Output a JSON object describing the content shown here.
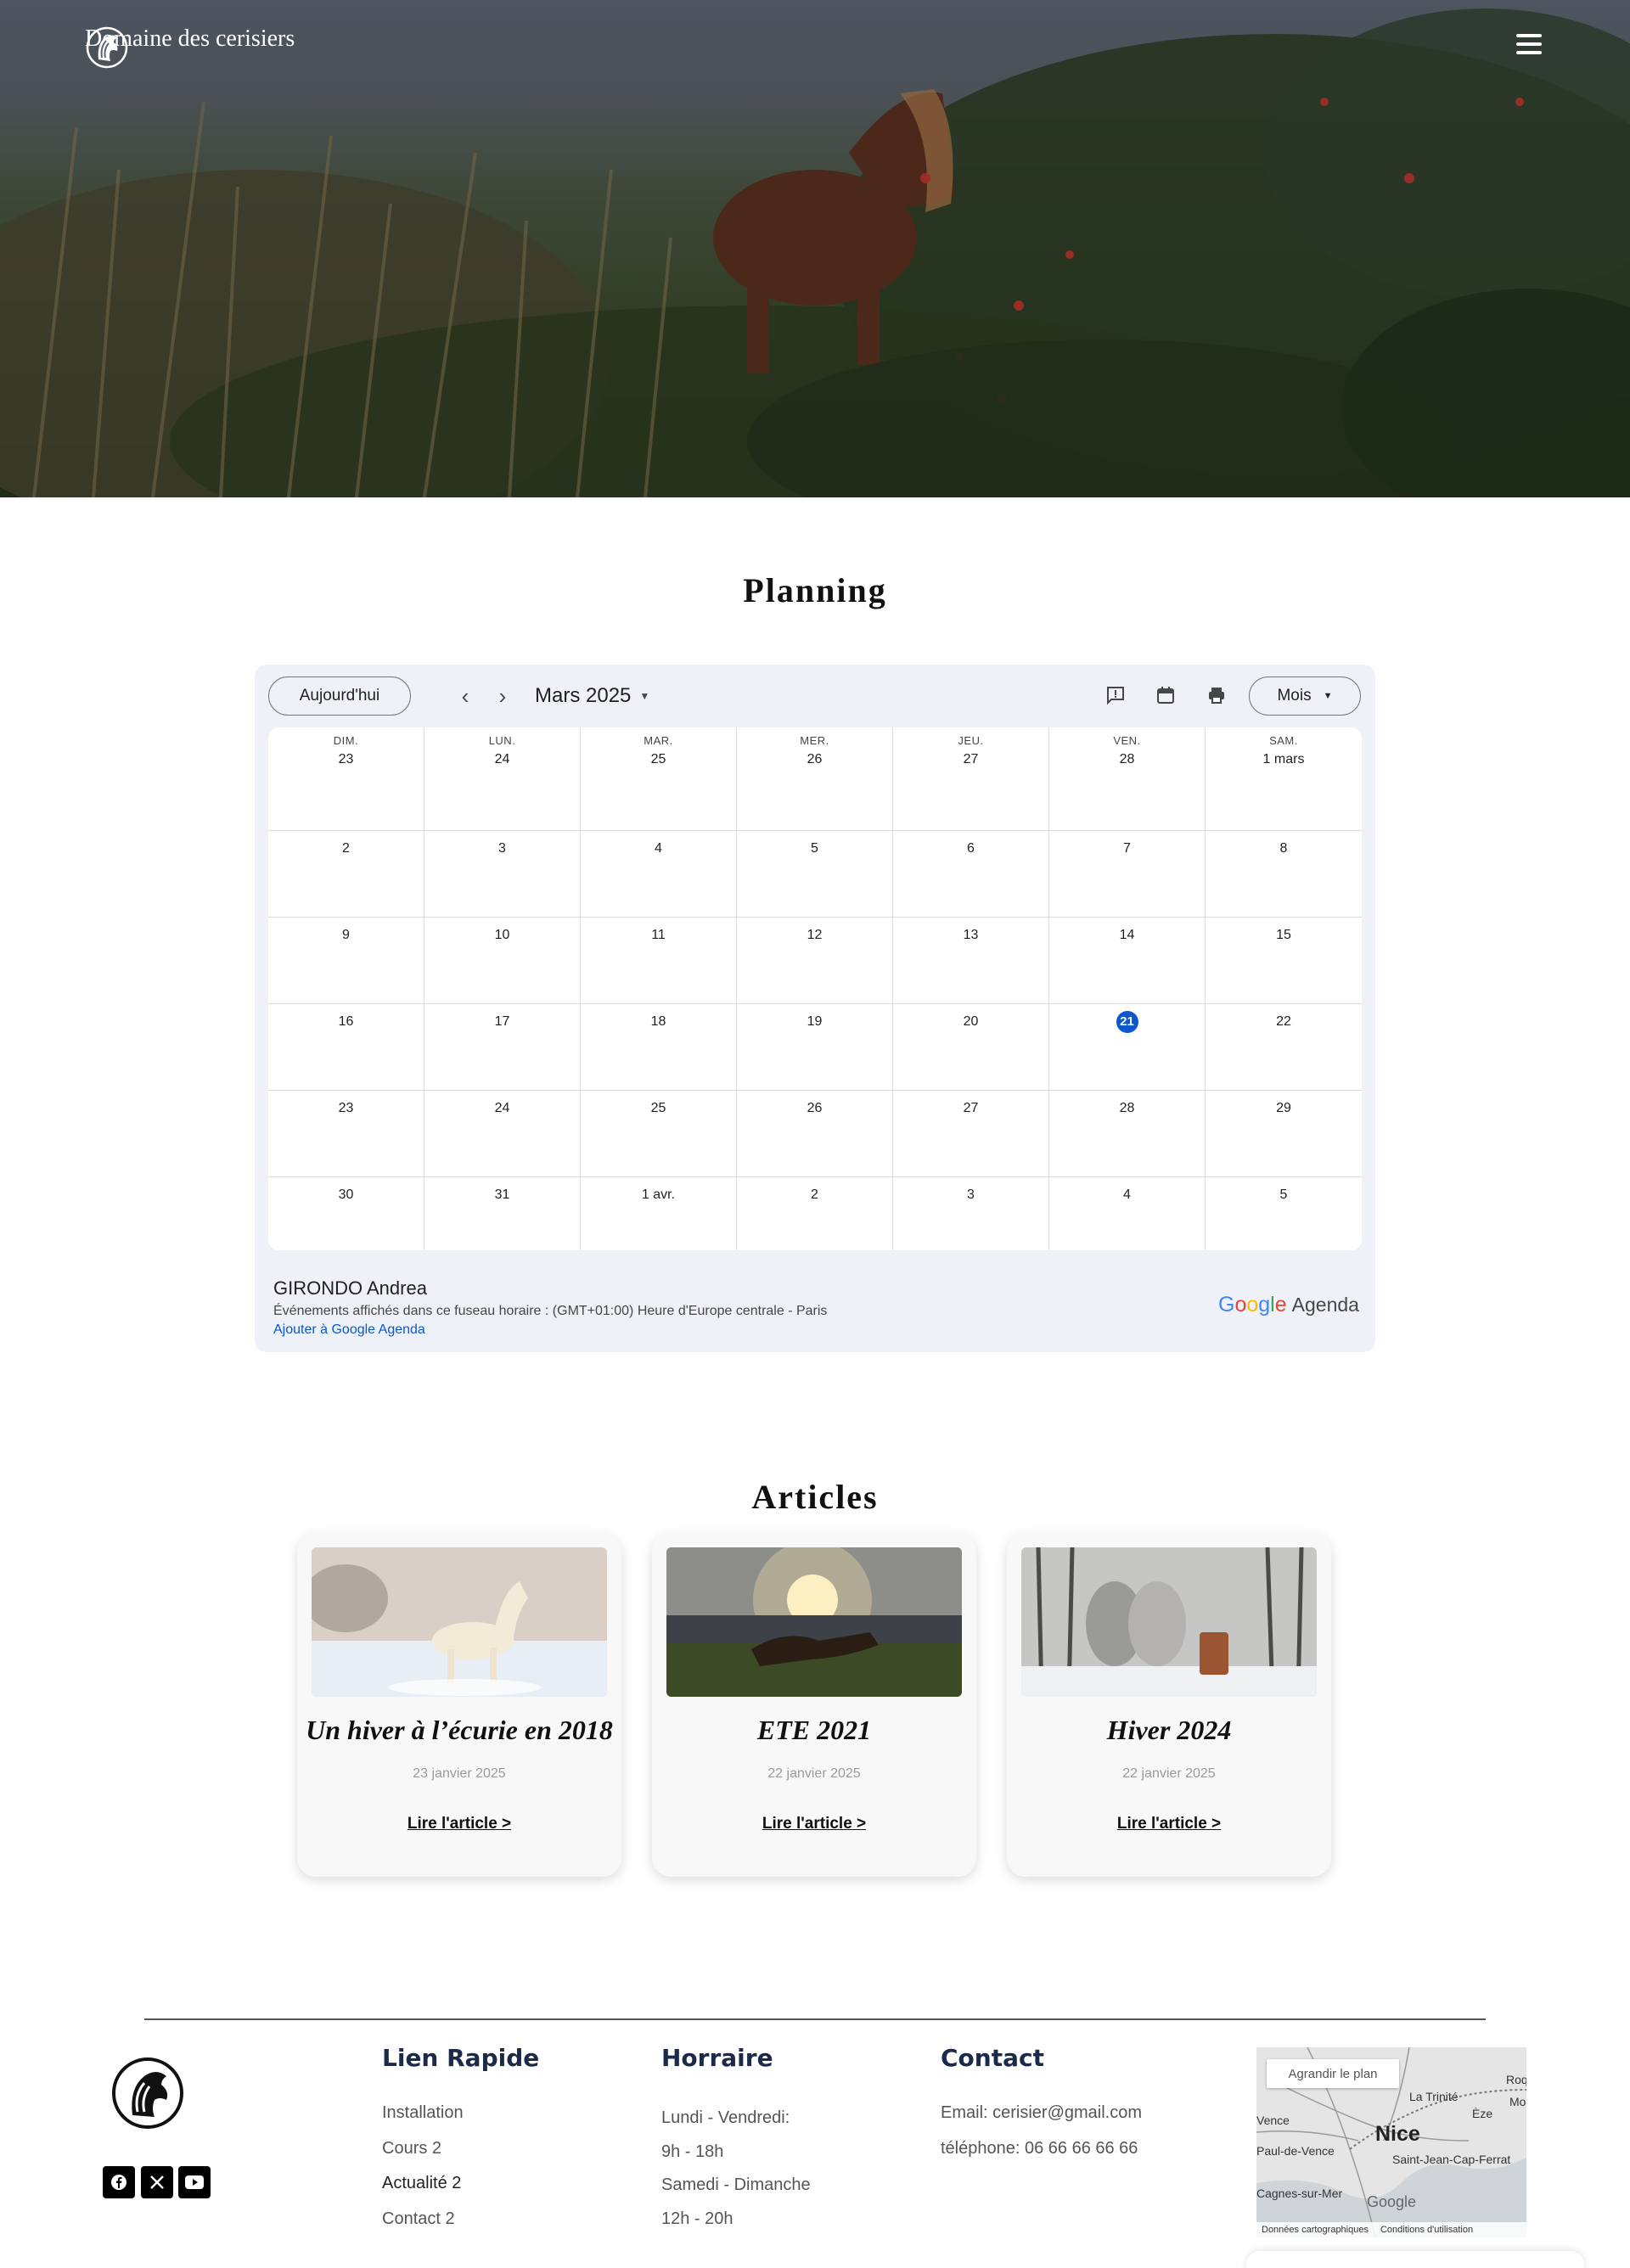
{
  "header": {
    "brand_name": "Domaine des cerisiers",
    "menu_icon": "hamburger-icon"
  },
  "planning": {
    "title": "Planning",
    "calendar": {
      "today_label": "Aujourd'hui",
      "prev_icon": "chevron-left-icon",
      "next_icon": "chevron-right-icon",
      "month_label": "Mars 2025",
      "view_label": "Mois",
      "tool_icons": [
        "feedback-icon",
        "calendar-icon",
        "print-icon"
      ],
      "weekdays": [
        "DIM.",
        "LUN.",
        "MAR.",
        "MER.",
        "JEU.",
        "VEN.",
        "SAM."
      ],
      "weeks": [
        [
          "23",
          "24",
          "25",
          "26",
          "27",
          "28",
          "1 mars"
        ],
        [
          "2",
          "3",
          "4",
          "5",
          "6",
          "7",
          "8"
        ],
        [
          "9",
          "10",
          "11",
          "12",
          "13",
          "14",
          "15"
        ],
        [
          "16",
          "17",
          "18",
          "19",
          "20",
          "21",
          "22"
        ],
        [
          "23",
          "24",
          "25",
          "26",
          "27",
          "28",
          "29"
        ],
        [
          "30",
          "31",
          "1 avr.",
          "2",
          "3",
          "4",
          "5"
        ]
      ],
      "today_day": "21",
      "owner": "GIRONDO Andrea",
      "timezone_note": "Événements affichés dans ce fuseau horaire : (GMT+01:00) Heure d'Europe centrale - Paris",
      "add_link": "Ajouter à Google Agenda",
      "logo_google": [
        "G",
        "o",
        "o",
        "g",
        "l",
        "e"
      ],
      "logo_agenda": "Agenda",
      "accent_color": "#0b57d0"
    }
  },
  "articles": {
    "title": "Articles",
    "items": [
      {
        "title": "Un hiver à l’écurie en 2018",
        "date": "23 janvier 2025",
        "link": "Lire l'article >",
        "image": "white-horse-snow"
      },
      {
        "title": "ETE 2021",
        "date": "22 janvier 2025",
        "link": "Lire l'article >",
        "image": "horses-sunset-coast"
      },
      {
        "title": "Hiver 2024",
        "date": "22 janvier 2025",
        "link": "Lire l'article >",
        "image": "horses-sleigh-forest"
      }
    ]
  },
  "footer": {
    "social": [
      "facebook-icon",
      "x-icon",
      "youtube-icon"
    ],
    "quick_links": {
      "heading": "Lien Rapide",
      "items": [
        "Installation",
        "Cours 2",
        "Actualité 2",
        "Contact 2"
      ]
    },
    "hours": {
      "heading": "Horraire",
      "items": [
        "Lundi - Vendredi:",
        "9h - 18h",
        "Samedi - Dimanche",
        "12h - 20h"
      ]
    },
    "contact": {
      "heading": "Contact",
      "email": "Email: cerisier@gmail.com",
      "phone": "téléphone: 06 66 66 66 66"
    },
    "map": {
      "enlarge_label": "Agrandir le plan",
      "city": "Nice",
      "labels": [
        "La Trinité",
        "Èze",
        "Vence",
        "Paul-de-Vence",
        "Saint-Jean-Cap-Ferrat",
        "Cagnes-sur-Mer",
        "Roq",
        "Mo"
      ],
      "google": "Google",
      "footer_left": "Données cartographiques",
      "footer_right": "Conditions d'utilisation"
    }
  }
}
